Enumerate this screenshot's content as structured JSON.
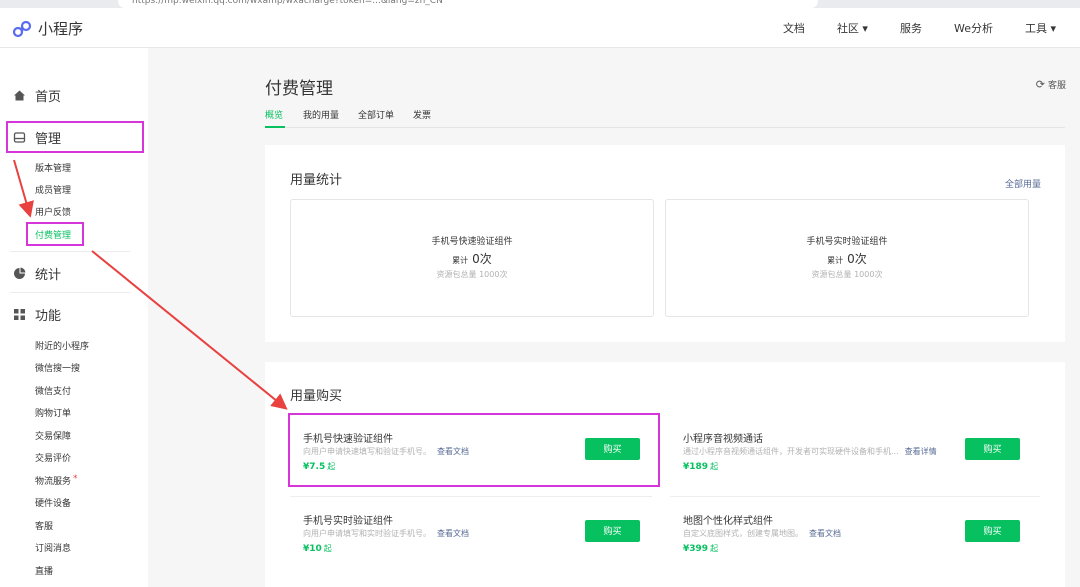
{
  "browser": {
    "url": "https://mp.weixin.qq.com/wxamp/wxacharge?token=...&lang=zh_CN"
  },
  "header": {
    "logo_text": "小程序",
    "nav": [
      "文档",
      "社区 ▾",
      "服务",
      "We分析",
      "工具 ▾"
    ]
  },
  "sidebar": {
    "home": "首页",
    "manage": "管理",
    "manage_items": [
      "版本管理",
      "成员管理",
      "用户反馈",
      "付费管理"
    ],
    "stats": "统计",
    "features": "功能",
    "feature_items": [
      "附近的小程序",
      "微信搜一搜",
      "微信支付",
      "购物订单",
      "交易保障",
      "交易评价",
      "物流服务",
      "硬件设备",
      "客服",
      "订阅消息",
      "直播"
    ],
    "badge_dot": "*"
  },
  "page": {
    "title": "付费管理",
    "help": "客服",
    "tabs": [
      "概览",
      "我的用量",
      "全部订单",
      "发票"
    ]
  },
  "usage": {
    "title": "用量统计",
    "all_link": "全部用量",
    "cards": [
      {
        "name": "手机号快速验证组件",
        "total_label": "累计",
        "total": "0次",
        "quota": "资源包总量 1000次"
      },
      {
        "name": "手机号实时验证组件",
        "total_label": "累计",
        "total": "0次",
        "quota": "资源包总量 1000次"
      }
    ]
  },
  "purchase": {
    "title": "用量购买",
    "items": [
      {
        "name": "手机号快速验证组件",
        "desc": "向用户申请快速填写和验证手机号。",
        "doc": "查看文档",
        "price": "¥7.5",
        "suffix": "起",
        "button": "购买"
      },
      {
        "name": "小程序音视频通话",
        "desc": "通过小程序音视频通话组件，开发者可实现硬件设备和手机...",
        "doc": "查看详情",
        "price": "¥189",
        "suffix": "起",
        "button": "购买"
      },
      {
        "name": "手机号实时验证组件",
        "desc": "向用户申请填写和实时验证手机号。",
        "doc": "查看文档",
        "price": "¥10",
        "suffix": "起",
        "button": "购买"
      },
      {
        "name": "地图个性化样式组件",
        "desc": "自定义底图样式，创建专属地图。",
        "doc": "查看文档",
        "price": "¥399",
        "suffix": "起",
        "button": "购买"
      }
    ]
  },
  "colors": {
    "accent": "#07c160",
    "link": "#576b95",
    "highlight": "#d535d9",
    "arrow": "#e8413f"
  }
}
